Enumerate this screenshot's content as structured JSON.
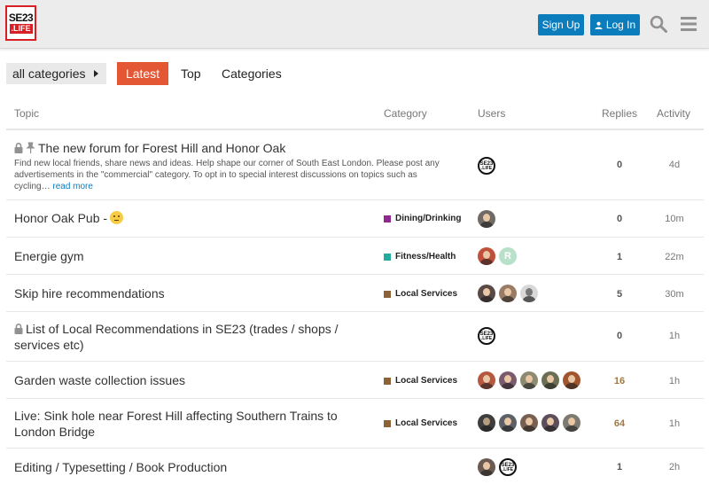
{
  "header": {
    "logo_line1": "SE23",
    "logo_line2": ".LIFE",
    "signup_label": "Sign Up",
    "login_label": "Log In"
  },
  "nav": {
    "category_dropdown": "all categories",
    "latest": "Latest",
    "top": "Top",
    "categories": "Categories"
  },
  "columns": {
    "topic": "Topic",
    "category": "Category",
    "users": "Users",
    "replies": "Replies",
    "activity": "Activity"
  },
  "topics": [
    {
      "title": "The new forum for Forest Hill and Honor Oak",
      "excerpt": "Find new local friends, share news and ideas. Help shape our corner of South East London. Please post any advertisements in the \"commercial\" category. To opt in to special interest discussions on topics such as cycling…",
      "read_more": "read more",
      "category": "",
      "replies": "0",
      "activity": "4d"
    },
    {
      "title": "Honor Oak Pub -",
      "category": "Dining/Drinking",
      "replies": "0",
      "activity": "10m"
    },
    {
      "title": "Energie gym",
      "category": "Fitness/Health",
      "replies": "1",
      "activity": "22m",
      "avatar_letter": "R"
    },
    {
      "title": "Skip hire recommendations",
      "category": "Local Services",
      "replies": "5",
      "activity": "30m"
    },
    {
      "title": "List of Local Recommendations in SE23 (trades / shops / services etc)",
      "category": "",
      "replies": "0",
      "activity": "1h"
    },
    {
      "title": "Garden waste collection issues",
      "category": "Local Services",
      "replies": "16",
      "activity": "1h"
    },
    {
      "title": "Live: Sink hole near Forest Hill affecting Southern Trains to London Bridge",
      "category": "Local Services",
      "replies": "64",
      "activity": "1h"
    },
    {
      "title": "Editing / Typesetting / Book Production",
      "category": "",
      "replies": "1",
      "activity": "2h"
    }
  ],
  "colors": {
    "primary": "#0b7dbd",
    "latest": "#e45735",
    "dining_drinking": "#92278f",
    "fitness_health": "#25aaa0",
    "local_services": "#8c6238",
    "hot_replies": "#a07a45"
  }
}
